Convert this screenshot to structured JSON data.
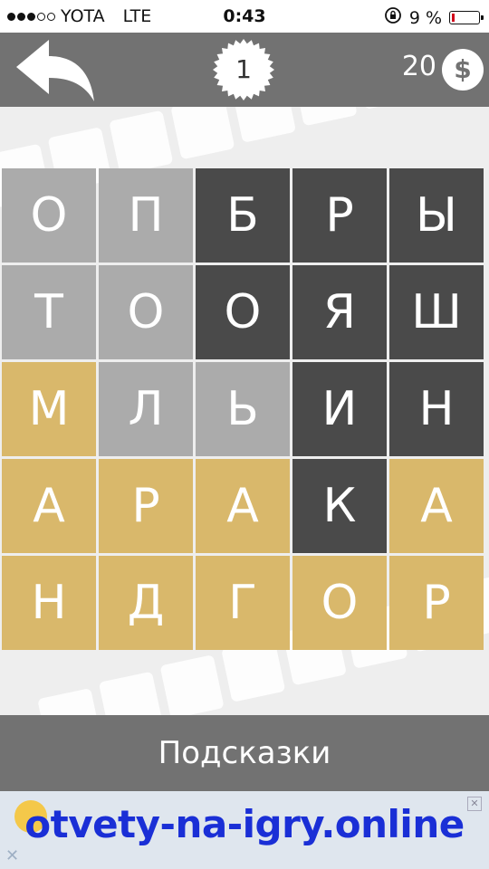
{
  "status_bar": {
    "carrier": "YOTA",
    "network": "LTE",
    "time": "0:43",
    "battery_percent": "9 %",
    "battery_level": 0.09,
    "signal_bars_filled": 3,
    "signal_bars_total": 5
  },
  "header": {
    "back_icon": "curved-back-arrow-icon",
    "level": "1",
    "coins": "20",
    "coin_symbol": "$"
  },
  "grid": {
    "rows": [
      [
        {
          "letter": "О",
          "state": "gray"
        },
        {
          "letter": "П",
          "state": "gray"
        },
        {
          "letter": "Б",
          "state": "dark"
        },
        {
          "letter": "Р",
          "state": "dark"
        },
        {
          "letter": "Ы",
          "state": "dark"
        }
      ],
      [
        {
          "letter": "Т",
          "state": "gray"
        },
        {
          "letter": "О",
          "state": "gray"
        },
        {
          "letter": "О",
          "state": "dark"
        },
        {
          "letter": "Я",
          "state": "dark"
        },
        {
          "letter": "Ш",
          "state": "dark"
        }
      ],
      [
        {
          "letter": "М",
          "state": "gold"
        },
        {
          "letter": "Л",
          "state": "gray"
        },
        {
          "letter": "Ь",
          "state": "gray"
        },
        {
          "letter": "И",
          "state": "dark"
        },
        {
          "letter": "Н",
          "state": "dark"
        }
      ],
      [
        {
          "letter": "А",
          "state": "gold"
        },
        {
          "letter": "Р",
          "state": "gold"
        },
        {
          "letter": "А",
          "state": "gold"
        },
        {
          "letter": "К",
          "state": "dark"
        },
        {
          "letter": "А",
          "state": "gold"
        }
      ],
      [
        {
          "letter": "Н",
          "state": "gold"
        },
        {
          "letter": "Д",
          "state": "gold"
        },
        {
          "letter": "Г",
          "state": "gold"
        },
        {
          "letter": "О",
          "state": "gold"
        },
        {
          "letter": "Р",
          "state": "gold"
        }
      ]
    ]
  },
  "hints_button": "Подсказки",
  "watermark": "otvety-na-igry.online",
  "colors": {
    "gray_tile": "#ababab",
    "dark_tile": "#4a4a4a",
    "gold_tile": "#d9b86b",
    "bar": "#727272",
    "watermark": "#1a2fd6"
  }
}
